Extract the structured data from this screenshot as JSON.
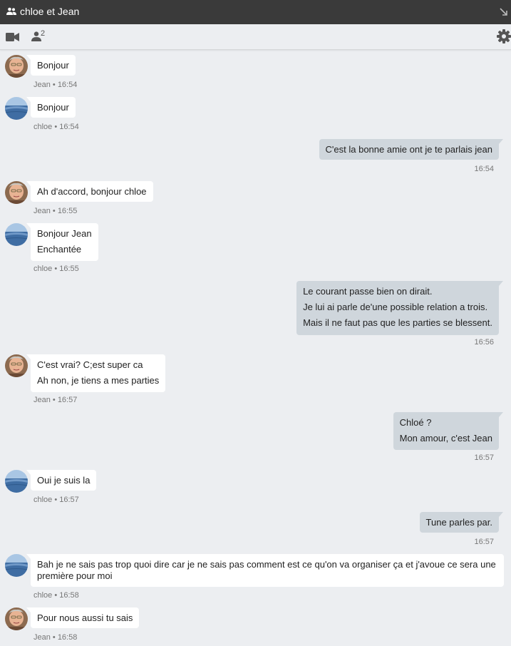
{
  "window": {
    "title": "chloe et Jean"
  },
  "toolbar": {
    "participants_count": "2"
  },
  "messages": [
    {
      "lines": [
        "Bonjour"
      ],
      "meta": "Jean • 16:54"
    },
    {
      "lines": [
        "Bonjour"
      ],
      "meta": "chloe • 16:54"
    },
    {
      "lines": [
        "C'est la bonne amie ont je te parlais jean"
      ],
      "meta": "16:54"
    },
    {
      "lines": [
        "Ah d'accord, bonjour chloe"
      ],
      "meta": "Jean • 16:55"
    },
    {
      "lines": [
        "Bonjour Jean",
        "Enchantée"
      ],
      "meta": "chloe • 16:55"
    },
    {
      "lines": [
        "Le courant passe bien on dirait.",
        "Je lui ai parle de'une possible relation a trois.",
        "Mais il ne faut pas que les parties se blessent."
      ],
      "meta": "16:56"
    },
    {
      "lines": [
        "C'est vrai? C;est super ca",
        "Ah non, je tiens a mes parties"
      ],
      "meta": "Jean • 16:57"
    },
    {
      "lines": [
        "Chloé ?",
        "Mon amour, c'est Jean"
      ],
      "meta": "16:57"
    },
    {
      "lines": [
        "Oui je suis la"
      ],
      "meta": "chloe • 16:57"
    },
    {
      "lines": [
        "Tune parles par."
      ],
      "meta": "16:57"
    },
    {
      "lines": [
        "Bah je ne sais pas trop quoi dire car je ne sais pas comment est ce qu'on va organiser ça et j'avoue ce sera une première pour moi"
      ],
      "meta": "chloe • 16:58"
    },
    {
      "lines": [
        "Pour nous aussi tu sais"
      ],
      "meta": "Jean • 16:58"
    }
  ],
  "colors": {
    "titlebar": "#3a3a3a",
    "background": "#eceef1",
    "incoming_bubble": "#ffffff",
    "outgoing_bubble": "#cfd6dc",
    "meta_text": "#777777"
  },
  "icons": [
    "group-icon",
    "resize-icon",
    "video-camera-icon",
    "person-icon",
    "gear-icon",
    "jean-avatar",
    "chloe-avatar"
  ]
}
